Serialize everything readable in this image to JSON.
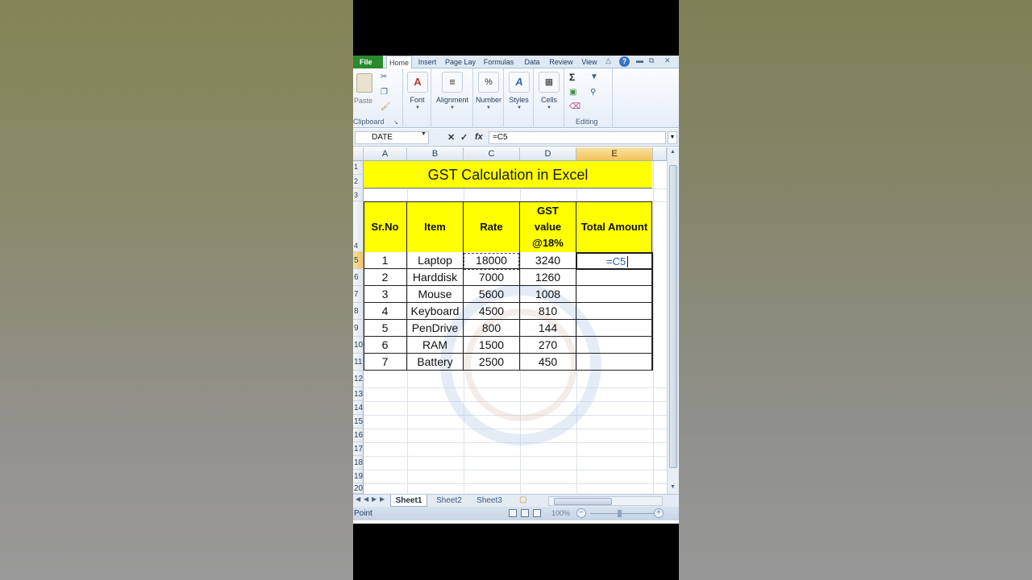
{
  "ribbon_tabs": {
    "file": "File",
    "home": "Home",
    "insert": "Insert",
    "page_layout": "Page Lay⁠",
    "formulas": "Formulas",
    "data": "Data",
    "review": "Review",
    "view": "View"
  },
  "ribbon": {
    "paste": "Paste",
    "clipboard": "Clipboard",
    "font": "Font",
    "alignment": "Alignment",
    "number": "Number",
    "number_symbol": "%",
    "styles": "Styles",
    "cells": "Cells",
    "editing": "Editing",
    "sigma": "Σ"
  },
  "formula_bar": {
    "name_box": "DATE",
    "formula": "=C5",
    "fx": "fx"
  },
  "columns": [
    "A",
    "B",
    "C",
    "D",
    "E"
  ],
  "rows": [
    "1",
    "2",
    "3",
    "4",
    "5",
    "6",
    "7",
    "8",
    "9",
    "10",
    "11",
    "12",
    "13",
    "14",
    "15",
    "16",
    "17",
    "18",
    "19",
    "20"
  ],
  "sheet_title": "GST Calculation in Excel",
  "table_headers": [
    "Sr.No",
    "Item",
    "Rate",
    "GST value @18%",
    "Total Amount"
  ],
  "table_rows": [
    {
      "sr": "1",
      "item": "Laptop",
      "rate": "18000",
      "gst": "3240"
    },
    {
      "sr": "2",
      "item": "Harddisk",
      "rate": "7000",
      "gst": "1260"
    },
    {
      "sr": "3",
      "item": "Mouse",
      "rate": "5600",
      "gst": "1008"
    },
    {
      "sr": "4",
      "item": "Keyboard",
      "rate": "4500",
      "gst": "810"
    },
    {
      "sr": "5",
      "item": "PenDrive",
      "rate": "800",
      "gst": "144"
    },
    {
      "sr": "6",
      "item": "RAM",
      "rate": "1500",
      "gst": "270"
    },
    {
      "sr": "7",
      "item": "Battery",
      "rate": "2500",
      "gst": "450"
    }
  ],
  "active_cell_edit": "=C5",
  "sheets": [
    "Sheet1",
    "Sheet2",
    "Sheet3"
  ],
  "status": {
    "mode": "Point",
    "zoom": "100%"
  },
  "colors": {
    "header_fill": "#ffff00",
    "file_tab": "#2a8a2e",
    "selected_header": "#f2c35a"
  }
}
